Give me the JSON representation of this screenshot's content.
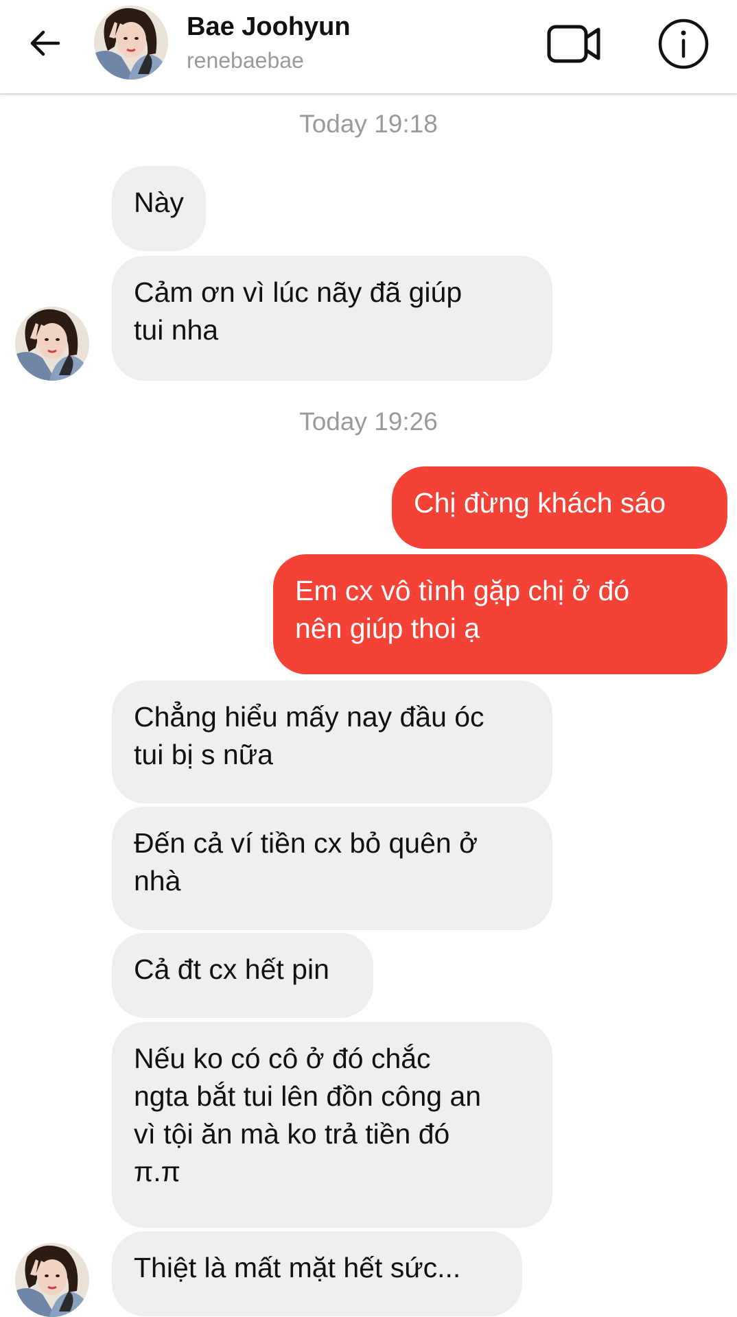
{
  "header": {
    "name": "Bae Joohyun",
    "username": "renebaebae",
    "icons": [
      "back-arrow-icon",
      "video-call-icon",
      "info-icon"
    ]
  },
  "colors": {
    "sent_bubble": "#f44336",
    "received_bubble": "#efefef",
    "timestamp_text": "#9a9a9a"
  },
  "timestamps": [
    "Today 19:18",
    "Today 19:26"
  ],
  "messages": [
    {
      "from": "them",
      "text": "Này"
    },
    {
      "from": "them",
      "text": "Cảm ơn vì lúc nãy đã giúp\ntui nha"
    },
    {
      "from": "me",
      "text": "Chị đừng khách sáo"
    },
    {
      "from": "me",
      "text": "Em cx vô tình gặp chị ở đó\nnên giúp thoi ạ"
    },
    {
      "from": "them",
      "text": "Chẳng hiểu mấy nay đầu óc\ntui bị s nữa"
    },
    {
      "from": "them",
      "text": "Đến cả ví tiền cx bỏ quên ở\nnhà"
    },
    {
      "from": "them",
      "text": "Cả đt cx hết pin"
    },
    {
      "from": "them",
      "text": "Nếu ko có cô ở đó chắc\nngta bắt tui lên đồn công an\nvì tội ăn mà ko trả tiền đó\nπ.π"
    },
    {
      "from": "them",
      "text": "Thiệt là mất mặt hết sức..."
    }
  ]
}
